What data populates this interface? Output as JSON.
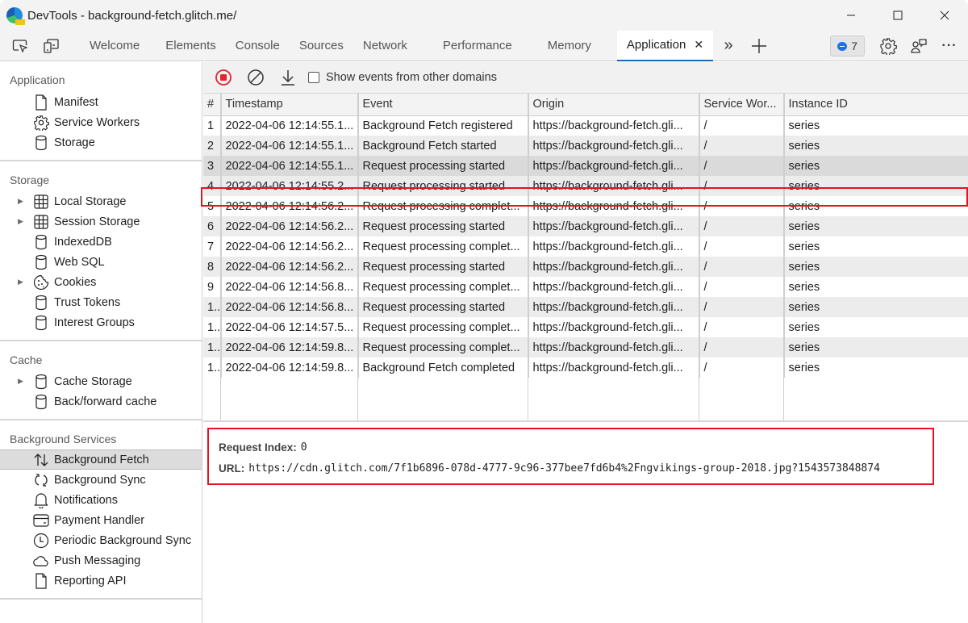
{
  "window": {
    "title": "DevTools - background-fetch.glitch.me/",
    "controls": {
      "minimize": "—",
      "maximize": "☐",
      "close": "✕"
    }
  },
  "tabbar": {
    "tabs": [
      {
        "label": "Welcome",
        "active": false
      },
      {
        "label": "Elements",
        "active": false
      },
      {
        "label": "Console",
        "active": false
      },
      {
        "label": "Sources",
        "active": false
      },
      {
        "label": "Network",
        "active": false
      },
      {
        "label": "Performance",
        "active": false
      },
      {
        "label": "Memory",
        "active": false
      },
      {
        "label": "Application",
        "active": true
      }
    ],
    "close_glyph": "✕",
    "more_tabs_glyph": "»",
    "new_tab_glyph": "+",
    "issues_count": "7",
    "more_options_glyph": "···"
  },
  "sidebar": {
    "sections": [
      {
        "title": "Application",
        "items": [
          {
            "label": "Manifest",
            "icon": "document-icon",
            "expandable": false
          },
          {
            "label": "Service Workers",
            "icon": "gear-icon",
            "expandable": false
          },
          {
            "label": "Storage",
            "icon": "database-icon",
            "expandable": false
          }
        ]
      },
      {
        "title": "Storage",
        "items": [
          {
            "label": "Local Storage",
            "icon": "grid-icon",
            "expandable": true
          },
          {
            "label": "Session Storage",
            "icon": "grid-icon",
            "expandable": true
          },
          {
            "label": "IndexedDB",
            "icon": "database-icon",
            "expandable": false
          },
          {
            "label": "Web SQL",
            "icon": "database-icon",
            "expandable": false
          },
          {
            "label": "Cookies",
            "icon": "cookie-icon",
            "expandable": true
          },
          {
            "label": "Trust Tokens",
            "icon": "database-icon",
            "expandable": false
          },
          {
            "label": "Interest Groups",
            "icon": "database-icon",
            "expandable": false
          }
        ]
      },
      {
        "title": "Cache",
        "items": [
          {
            "label": "Cache Storage",
            "icon": "database-icon",
            "expandable": true
          },
          {
            "label": "Back/forward cache",
            "icon": "database-icon",
            "expandable": false
          }
        ]
      },
      {
        "title": "Background Services",
        "items": [
          {
            "label": "Background Fetch",
            "icon": "up-down-arrows-icon",
            "expandable": false,
            "selected": true
          },
          {
            "label": "Background Sync",
            "icon": "sync-icon",
            "expandable": false
          },
          {
            "label": "Notifications",
            "icon": "bell-icon",
            "expandable": false
          },
          {
            "label": "Payment Handler",
            "icon": "card-icon",
            "expandable": false
          },
          {
            "label": "Periodic Background Sync",
            "icon": "clock-icon",
            "expandable": false
          },
          {
            "label": "Push Messaging",
            "icon": "cloud-icon",
            "expandable": false
          },
          {
            "label": "Reporting API",
            "icon": "document-icon",
            "expandable": false
          }
        ]
      }
    ]
  },
  "toolbar": {
    "record_label": "Record",
    "clear_label": "Clear",
    "save_label": "Save events",
    "checkbox_label": "Show events from other domains",
    "checkbox_checked": false
  },
  "grid": {
    "columns": [
      "#",
      "Timestamp",
      "Event",
      "Origin",
      "Service Wor...",
      "Instance ID"
    ],
    "selected_row": 2,
    "rows": [
      [
        "1",
        "2022-04-06 12:14:55.1...",
        "Background Fetch registered",
        "https://background-fetch.gli...",
        "/",
        "series"
      ],
      [
        "2",
        "2022-04-06 12:14:55.1...",
        "Background Fetch started",
        "https://background-fetch.gli...",
        "/",
        "series"
      ],
      [
        "3",
        "2022-04-06 12:14:55.1...",
        "Request processing started",
        "https://background-fetch.gli...",
        "/",
        "series"
      ],
      [
        "4",
        "2022-04-06 12:14:55.2...",
        "Request processing started",
        "https://background-fetch.gli...",
        "/",
        "series"
      ],
      [
        "5",
        "2022-04-06 12:14:56.2...",
        "Request processing complet...",
        "https://background-fetch.gli...",
        "/",
        "series"
      ],
      [
        "6",
        "2022-04-06 12:14:56.2...",
        "Request processing started",
        "https://background-fetch.gli...",
        "/",
        "series"
      ],
      [
        "7",
        "2022-04-06 12:14:56.2...",
        "Request processing complet...",
        "https://background-fetch.gli...",
        "/",
        "series"
      ],
      [
        "8",
        "2022-04-06 12:14:56.2...",
        "Request processing started",
        "https://background-fetch.gli...",
        "/",
        "series"
      ],
      [
        "9",
        "2022-04-06 12:14:56.8...",
        "Request processing complet...",
        "https://background-fetch.gli...",
        "/",
        "series"
      ],
      [
        "1..",
        "2022-04-06 12:14:56.8...",
        "Request processing started",
        "https://background-fetch.gli...",
        "/",
        "series"
      ],
      [
        "1..",
        "2022-04-06 12:14:57.5...",
        "Request processing complet...",
        "https://background-fetch.gli...",
        "/",
        "series"
      ],
      [
        "1..",
        "2022-04-06 12:14:59.8...",
        "Request processing complet...",
        "https://background-fetch.gli...",
        "/",
        "series"
      ],
      [
        "1..",
        "2022-04-06 12:14:59.8...",
        "Background Fetch completed",
        "https://background-fetch.gli...",
        "/",
        "series"
      ]
    ]
  },
  "detail": {
    "request_index_label": "Request Index:",
    "request_index_value": "0",
    "url_label": "URL:",
    "url_value": "https://cdn.glitch.com/7f1b6896-078d-4777-9c96-377bee7fd6b4%2Fngvikings-group-2018.jpg?1543573848874"
  },
  "colors": {
    "accent": "#0f6cbd",
    "highlight_border": "#e81123",
    "record_red": "#e0252b"
  }
}
